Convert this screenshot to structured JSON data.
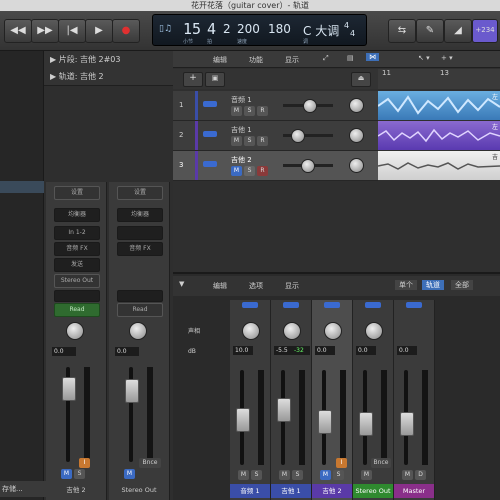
{
  "window": {
    "title": "花开花落（guitar cover）- 轨道"
  },
  "transport": {
    "rewind": "◀◀",
    "forward": "▶▶",
    "to_start": "|◀",
    "play": "▶",
    "record": "●"
  },
  "lcd": {
    "bar": "15",
    "beat": "4",
    "sub": "2",
    "tempo": "200",
    "division": "180",
    "key": "C 大调",
    "sig_top": "4",
    "sig_bot": "4",
    "bar_label": "小节",
    "beat_label": "拍",
    "tempo_label": "速度",
    "key_label": "调"
  },
  "right_tools": {
    "counter": "+234"
  },
  "inspector": {
    "region_header": "片段: 吉他 2#03",
    "track_header": "轨道: 吉他 2",
    "left_button": "存储...",
    "strip1": {
      "setting": "设置",
      "eq": "均衡器",
      "input": "In 1-2",
      "fx": "音频 FX",
      "send": "发送",
      "output": "Stereo Out",
      "auto": "Read",
      "value": "0.0",
      "name": "吉他 2",
      "m": "M",
      "s": "S"
    },
    "strip2": {
      "setting": "设置",
      "eq": "均衡器",
      "fx": "音频 FX",
      "auto": "Read",
      "value": "0.0",
      "name": "Stereo Out",
      "bnce": "Bnce",
      "m": "M",
      "s": "S"
    }
  },
  "tracks_header": {
    "edit": "编辑",
    "function": "功能",
    "view": "显示",
    "add": "+",
    "ruler": [
      "11",
      "13"
    ]
  },
  "tracks": [
    {
      "num": "1",
      "name": "音频 1",
      "m": "M",
      "s": "S",
      "r": "R"
    },
    {
      "num": "2",
      "name": "吉他 1",
      "m": "M",
      "s": "S",
      "r": "R"
    },
    {
      "num": "3",
      "name": "吉他 2",
      "m": "M",
      "s": "S",
      "r": "R"
    }
  ],
  "region_labels": [
    "左",
    "左",
    "吉"
  ],
  "mixer_header": {
    "edit": "编辑",
    "options": "选项",
    "view": "显示",
    "single": "单个",
    "tracks": "轨道",
    "all": "全部"
  },
  "mixer_labels": {
    "pan": "声相",
    "db": "dB"
  },
  "mixer_strips": [
    {
      "name": "音频 1",
      "value": "10.0",
      "peak": "",
      "m": "M",
      "s": "S",
      "color": "#3a4ea8"
    },
    {
      "name": "吉他 1",
      "value": "-5.5",
      "peak": "-32",
      "m": "M",
      "s": "S",
      "color": "#3a4ea8"
    },
    {
      "name": "吉他 2",
      "value": "0.0",
      "peak": "",
      "m": "M",
      "s": "S",
      "color": "#5a3aa8"
    },
    {
      "name": "Stereo Out",
      "value": "0.0",
      "peak": "",
      "m": "M",
      "s": "S",
      "color": "#2f8a2f",
      "bnce": "Bnce"
    },
    {
      "name": "Master",
      "value": "0.0",
      "peak": "",
      "m": "M",
      "s": "D",
      "color": "#8a2f8a"
    }
  ]
}
